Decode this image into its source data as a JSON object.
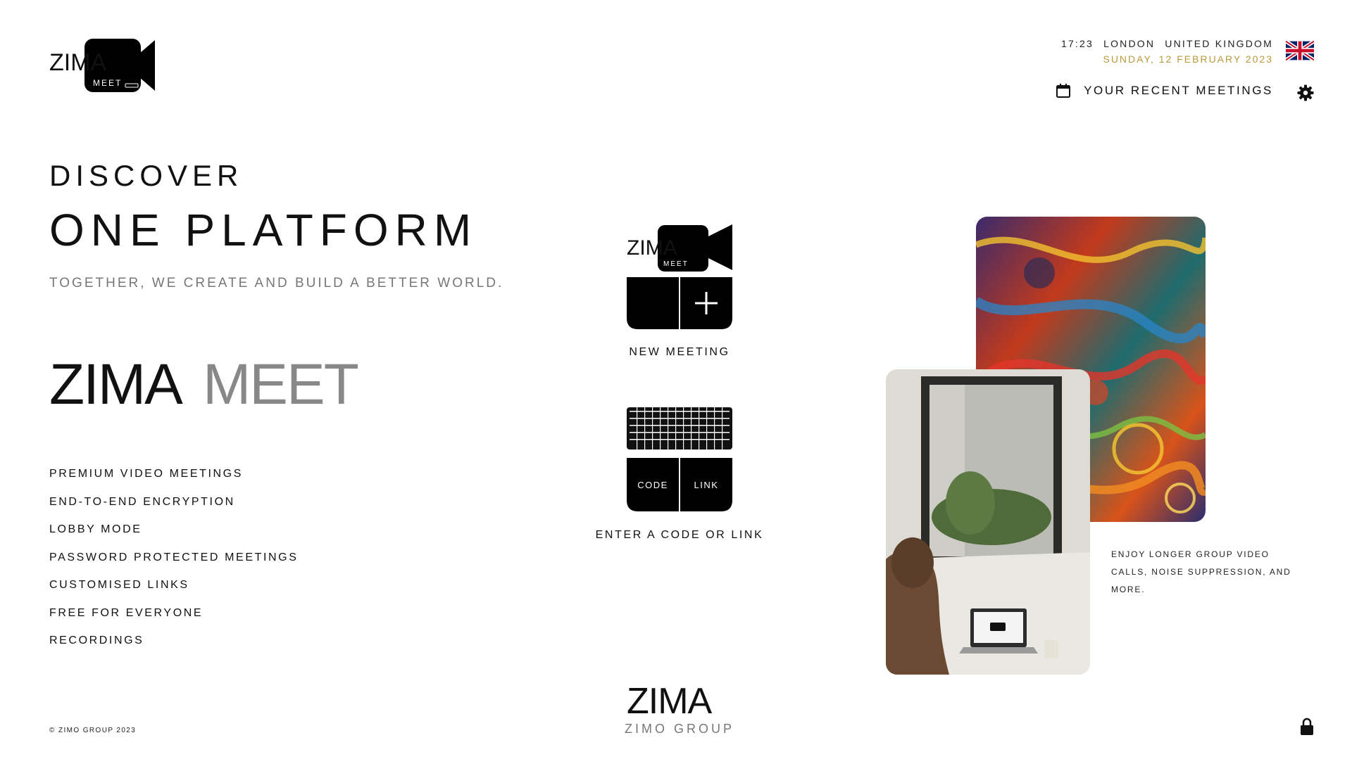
{
  "header": {
    "logo": {
      "word": "ZIMA",
      "sub": "MEET"
    },
    "time": "17:23",
    "city": "LONDON",
    "country": "UNITED KINGDOM",
    "date": "SUNDAY, 12 FEBRUARY 2023",
    "recent_meetings_label": "YOUR RECENT MEETINGS",
    "flag_icon": "uk-flag-icon",
    "calendar_icon": "calendar-icon",
    "settings_icon": "gear-icon"
  },
  "hero": {
    "eyebrow": "DISCOVER",
    "title": "ONE PLATFORM",
    "tagline": "TOGETHER, WE CREATE AND BUILD A BETTER WORLD."
  },
  "wordmark": {
    "part1": "ZIMA",
    "part2": "MEET"
  },
  "features": [
    "PREMIUM VIDEO MEETINGS",
    "END-TO-END ENCRYPTION",
    "LOBBY MODE",
    "PASSWORD PROTECTED MEETINGS",
    "CUSTOMISED LINKS",
    "FREE FOR EVERYONE",
    "RECORDINGS"
  ],
  "actions": {
    "new_meeting": {
      "label": "NEW MEETING",
      "logo_word": "ZIMA",
      "logo_sub": "MEET"
    },
    "join": {
      "label": "ENTER A CODE OR LINK",
      "code_label": "CODE",
      "link_label": "LINK"
    }
  },
  "footer": {
    "copyright": "© ZIMO GROUP 2023",
    "group_word": "ZIMA",
    "group_label": "ZIMO GROUP",
    "lock_icon": "lock-icon"
  },
  "promo": {
    "text": "ENJOY LONGER GROUP VIDEO CALLS, NOISE SUPPRESSION, AND MORE."
  },
  "colors": {
    "accent_gold": "#b9993c",
    "text": "#111111",
    "muted": "#777777"
  }
}
